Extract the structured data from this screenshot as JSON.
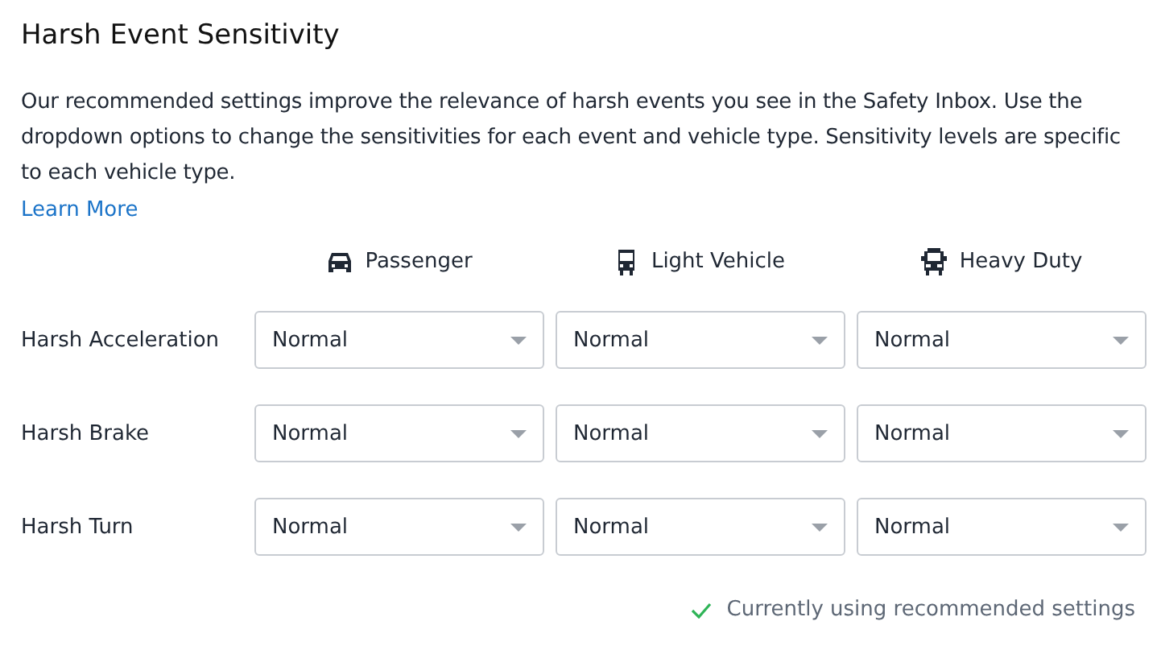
{
  "title": "Harsh Event Sensitivity",
  "description": "Our recommended settings improve the relevance of harsh events you see in the Safety Inbox. Use the dropdown options to change the sensitivities for each event and vehicle type. Sensitivity levels are specific to each vehicle type.",
  "learn_more_link": "Learn More",
  "columns": [
    {
      "kind": "car",
      "label": "Passenger"
    },
    {
      "kind": "van",
      "label": "Light Vehicle"
    },
    {
      "kind": "truck",
      "label": "Heavy Duty"
    }
  ],
  "rows": [
    {
      "label": "Harsh Acceleration",
      "values": [
        "Normal",
        "Normal",
        "Normal"
      ]
    },
    {
      "label": "Harsh Brake",
      "values": [
        "Normal",
        "Normal",
        "Normal"
      ]
    },
    {
      "label": "Harsh Turn",
      "values": [
        "Normal",
        "Normal",
        "Normal"
      ]
    }
  ],
  "status": "Currently using recommended settings"
}
